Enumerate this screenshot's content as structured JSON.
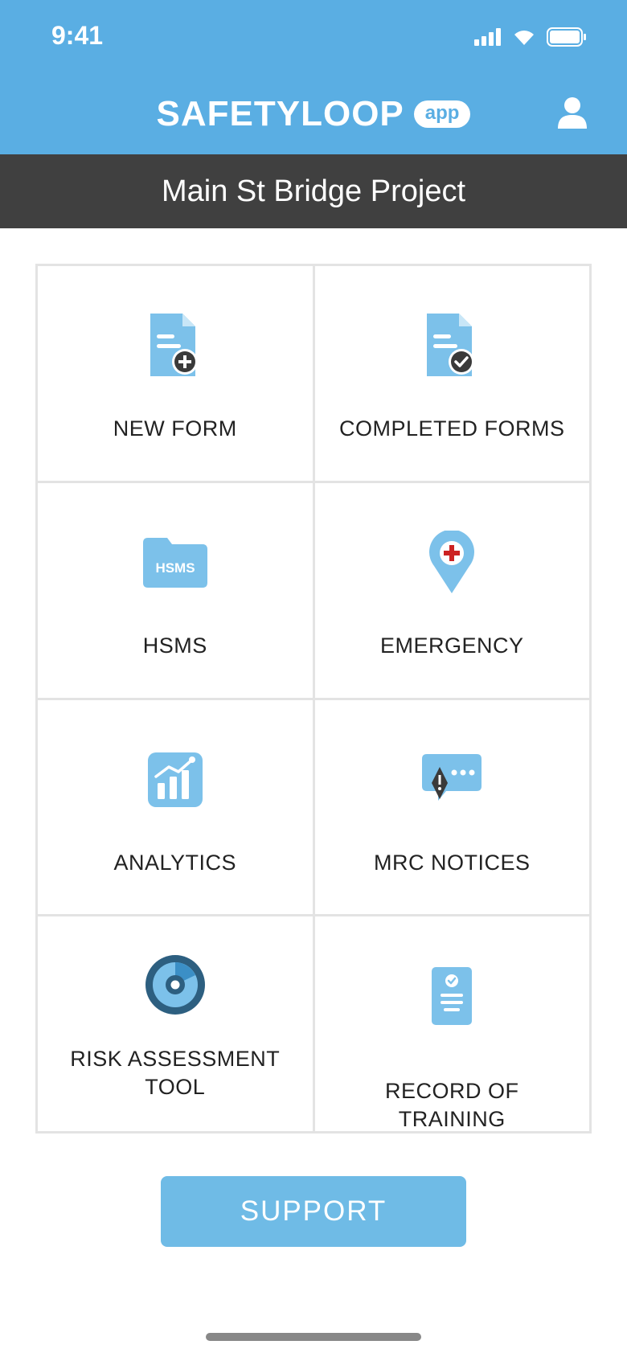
{
  "status_bar": {
    "time": "9:41"
  },
  "header": {
    "brand_name": "SAFETYLOOP",
    "brand_badge": "app",
    "profile_icon": "user-icon"
  },
  "project": {
    "name": "Main St Bridge Project"
  },
  "tiles": [
    {
      "label": "NEW FORM",
      "icon": "document-add-icon"
    },
    {
      "label": "COMPLETED FORMS",
      "icon": "document-check-icon"
    },
    {
      "label": "HSMS",
      "icon": "folder-icon",
      "icon_text": "HSMS"
    },
    {
      "label": "EMERGENCY",
      "icon": "location-cross-icon"
    },
    {
      "label": "ANALYTICS",
      "icon": "chart-icon"
    },
    {
      "label": "MRC NOTICES",
      "icon": "alert-message-icon"
    },
    {
      "label": "RISK ASSESSMENT TOOL",
      "icon": "target-icon"
    },
    {
      "label": "RECORD OF TRAINING",
      "icon": "badge-check-icon"
    }
  ],
  "support": {
    "label": "SUPPORT"
  },
  "colors": {
    "header_blue": "#5aaee3",
    "icon_blue": "#7cc1ea",
    "project_bar": "#404040",
    "button_blue": "#6fbbe6",
    "dark_icon": "#3a3a3a"
  }
}
